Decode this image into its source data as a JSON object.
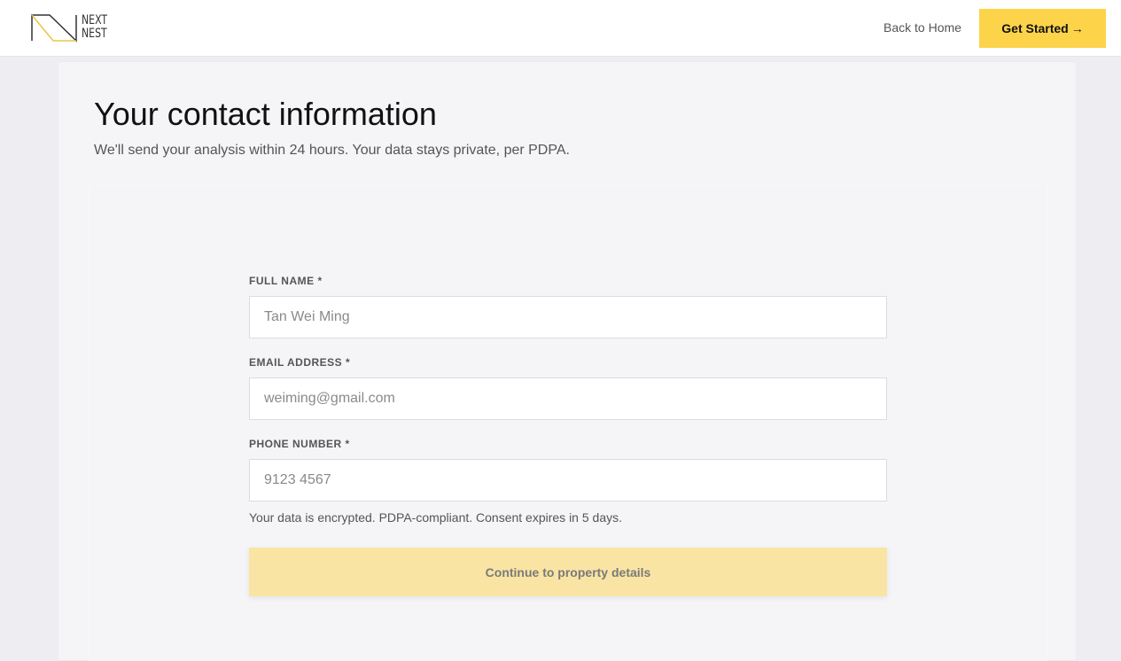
{
  "brand": {
    "logo_line1": "NEXT",
    "logo_line2": "NEST"
  },
  "nav": {
    "back_label": "Back to Home",
    "cta_label": "Get Started",
    "cta_arrow": "→"
  },
  "page": {
    "title": "Your contact information",
    "subtitle": "We'll send your analysis within 24 hours. Your data stays private, per PDPA."
  },
  "form": {
    "fields": [
      {
        "label": "FULL NAME *",
        "placeholder": "Tan Wei Ming",
        "value": ""
      },
      {
        "label": "EMAIL ADDRESS *",
        "placeholder": "weiming@gmail.com",
        "value": ""
      },
      {
        "label": "PHONE NUMBER *",
        "placeholder": "9123 4567",
        "value": ""
      }
    ],
    "note": "Your data is encrypted. PDPA-compliant. Consent expires in 5 days.",
    "submit_label": "Continue to property details"
  },
  "colors": {
    "accent": "#fdd34a",
    "accent_disabled": "#f9e4a3",
    "background": "#eeeef2",
    "card": "#f5f5f7"
  }
}
